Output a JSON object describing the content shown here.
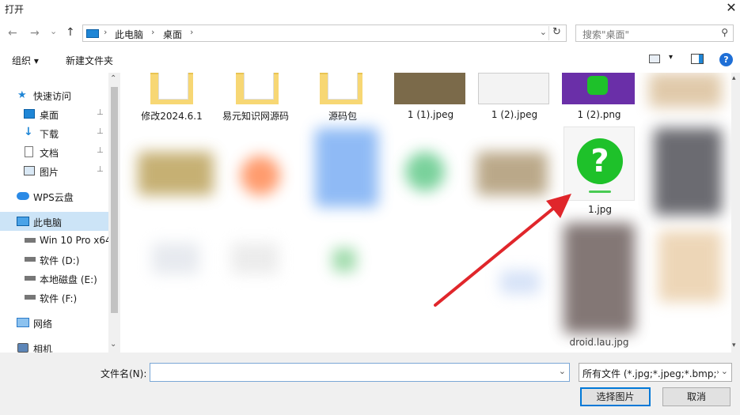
{
  "window": {
    "title": "打开",
    "close_glyph": "✕"
  },
  "nav": {
    "back": "←",
    "forward": "→",
    "recent": "⌄",
    "up": "↑",
    "breadcrumb": [
      "此电脑",
      "桌面"
    ],
    "crumb_sep": "›",
    "dropdown_glyph": "⌄",
    "refresh_glyph": "↻",
    "search_placeholder": "搜索\"桌面\"",
    "search_glyph": "⚲"
  },
  "toolbar": {
    "organize": "组织 ▾",
    "new_folder": "新建文件夹",
    "view_dd": "▾",
    "help": "?"
  },
  "sidebar": {
    "items": [
      {
        "label": "快速访问",
        "icon": "star-icon",
        "pinned": false
      },
      {
        "label": "桌面",
        "icon": "desktop-icon",
        "pinned": true
      },
      {
        "label": "下载",
        "icon": "download-icon",
        "pinned": true
      },
      {
        "label": "文档",
        "icon": "document-icon",
        "pinned": true
      },
      {
        "label": "图片",
        "icon": "picture-icon",
        "pinned": true
      },
      {
        "label": "WPS云盘",
        "icon": "cloud-icon",
        "pinned": false
      },
      {
        "label": "此电脑",
        "icon": "computer-icon",
        "pinned": false,
        "selected": true
      },
      {
        "label": "Win 10 Pro x64",
        "icon": "drive-icon",
        "pinned": false
      },
      {
        "label": "软件 (D:)",
        "icon": "drive-icon",
        "pinned": false
      },
      {
        "label": "本地磁盘 (E:)",
        "icon": "drive-icon",
        "pinned": false
      },
      {
        "label": "软件 (F:)",
        "icon": "drive-icon",
        "pinned": false
      },
      {
        "label": "网络",
        "icon": "network-icon",
        "pinned": false
      },
      {
        "label": "相机",
        "icon": "camera-icon",
        "pinned": false
      }
    ],
    "pin_glyph": "📌",
    "scroll_up": "⌃",
    "scroll_down": "⌄"
  },
  "files": {
    "row1": [
      "修改2024.6.1",
      "易元知识网源码",
      "源码包",
      "1 (1).jpeg",
      "1 (2).jpeg",
      "1 (2).png"
    ],
    "highlighted": {
      "label": "1.jpg",
      "glyph": "?"
    },
    "partial": "droid.lau.jpg"
  },
  "bottom": {
    "filename_label": "文件名(N):",
    "filename_value": "",
    "dropdown_glyph": "⌄",
    "filetype": "所有文件 (*.jpg;*.jpeg;*.bmp;*.",
    "open_button": "选择图片",
    "cancel_button": "取消"
  },
  "colors": {
    "accent": "#0078d7",
    "selected_bg": "#cce4f7",
    "question_green": "#1ec12a",
    "arrow_red": "#e0262b"
  }
}
